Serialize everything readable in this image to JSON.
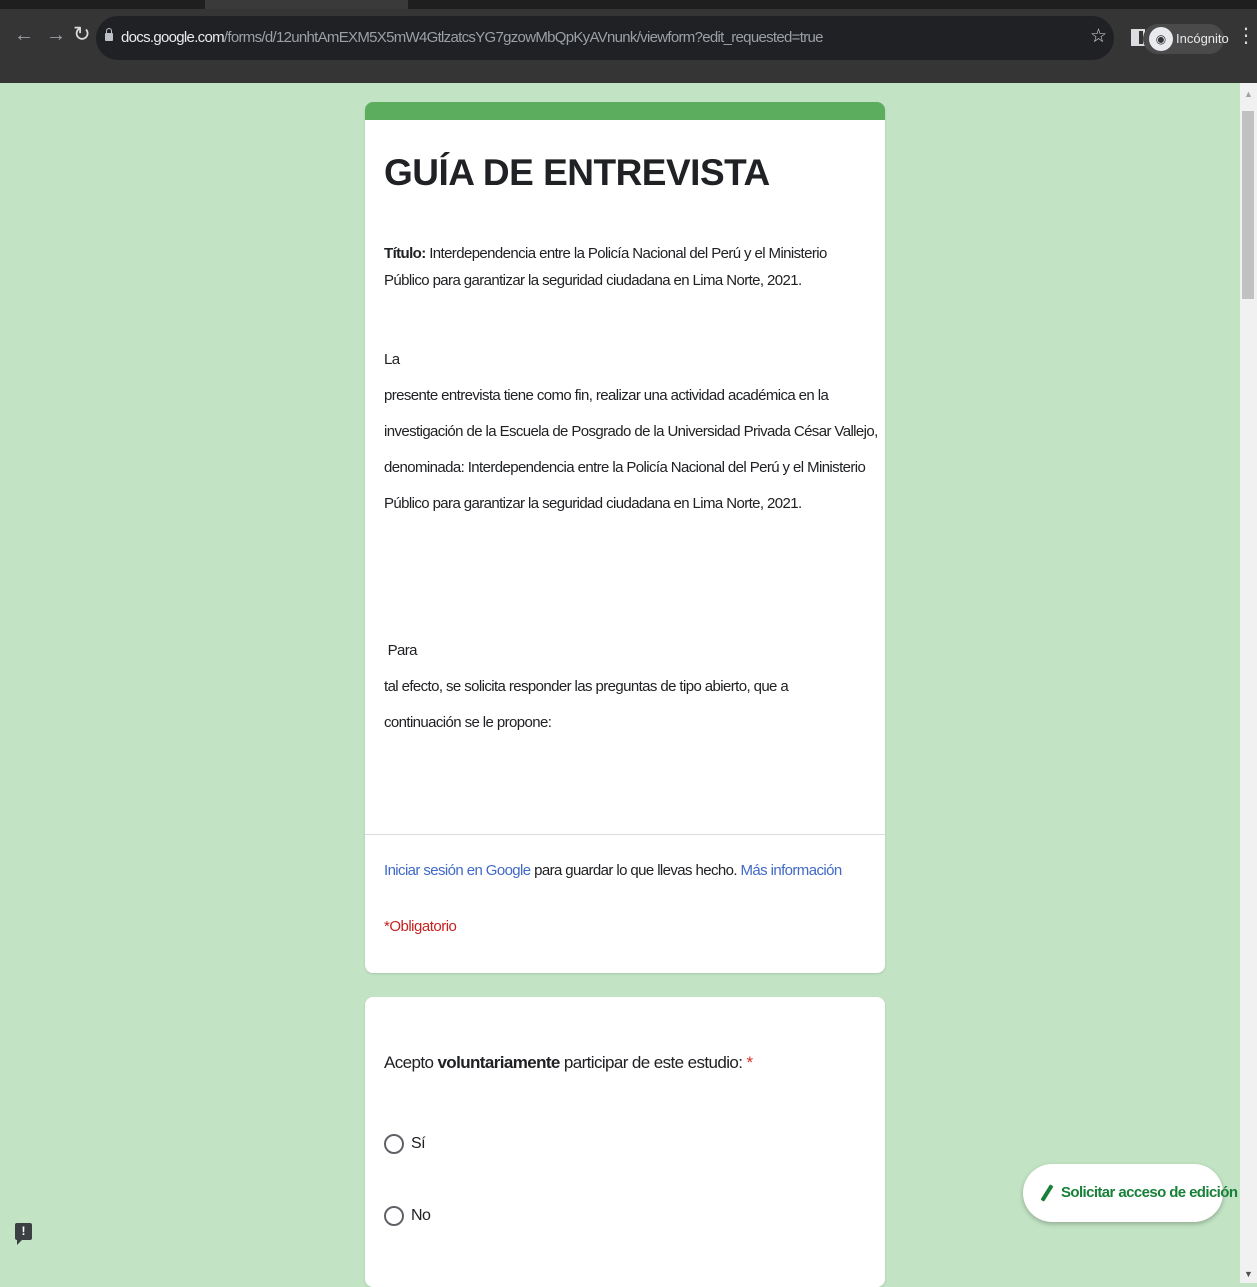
{
  "browser": {
    "url_host": "docs.google.com",
    "url_path": "/forms/d/12unhtAmEXM5X5mW4GtlzatcsYG7gzowMbQpKyAVnunk/viewform?edit_requested=true",
    "profile_label": "Incógnito",
    "icons": {
      "back": "arrow-left-icon",
      "forward": "arrow-right-icon",
      "reload": "reload-icon",
      "lock": "lock-icon",
      "bookmark": "star-icon",
      "side_panel": "side-panel-icon",
      "incognito": "incognito-icon",
      "menu": "kebab-menu-icon"
    }
  },
  "form": {
    "accent_color": "#5cad5e",
    "title": "GUÍA DE ENTREVISTA",
    "title_label": "Título:",
    "title_line1": " Interdependencia entre la Policía Nacional del Perú y el Ministerio",
    "title_line2": "Público para garantizar la seguridad ciudadana en Lima Norte, 2021.",
    "para1": [
      "La",
      "presente entrevista tiene como fin, realizar una actividad académica en la",
      "investigación de la Escuela de Posgrado de la Universidad Privada César Vallejo,",
      "denominada: Interdependencia entre la Policía Nacional del Perú y el Ministerio",
      "Público para garantizar la seguridad ciudadana en Lima Norte, 2021."
    ],
    "para2": [
      " Para",
      "tal efecto, se solicita responder las preguntas de tipo abierto, que a",
      "continuación se le propone:"
    ],
    "signin_link": "Iniciar sesión en Google",
    "signin_text": " para guardar lo que llevas hecho. ",
    "more_info_link": "Más información",
    "required_note": "*Obligatorio"
  },
  "question": {
    "label_pre": "Acepto ",
    "label_bold": "voluntariamente",
    "label_post": " participar de este estudio: ",
    "required_mark": "*",
    "options": [
      "Sí",
      "No"
    ]
  },
  "fab": {
    "label": "Solicitar acceso de edición",
    "icon": "pencil-icon",
    "color": "#188038"
  },
  "report_icon": "report-issue-icon"
}
